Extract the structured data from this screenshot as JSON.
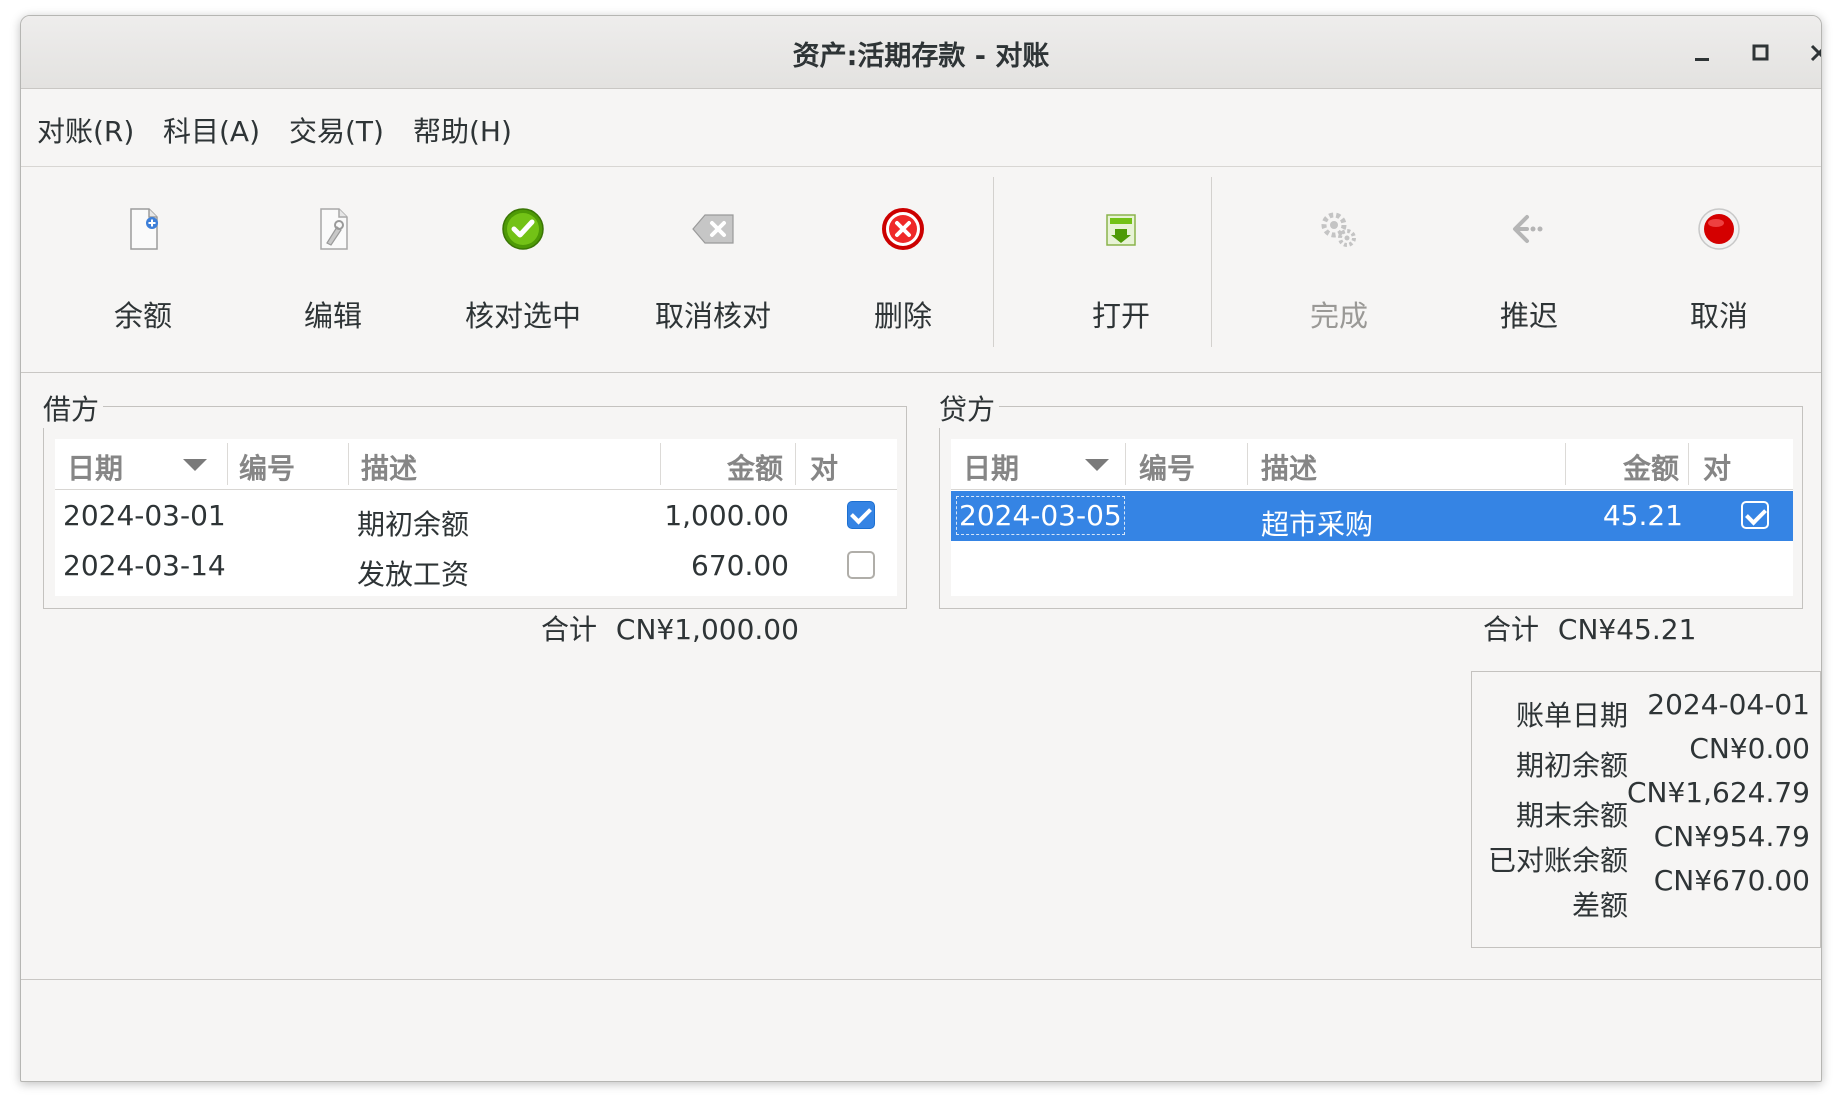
{
  "window": {
    "title": "资产:活期存款 - 对账",
    "controls": {
      "minimize": "–",
      "maximize": "□",
      "close": "✕"
    }
  },
  "menubar": {
    "items": [
      "对账(R)",
      "科目(A)",
      "交易(T)",
      "帮助(H)"
    ]
  },
  "toolbar": {
    "buttons": [
      {
        "label": "余额",
        "icon": "new-balance-icon",
        "enabled": true
      },
      {
        "label": "编辑",
        "icon": "edit-icon",
        "enabled": true
      },
      {
        "label": "核对选中",
        "icon": "reconcile-check-icon",
        "enabled": true
      },
      {
        "label": "取消核对",
        "icon": "unreconcile-backspace-icon",
        "enabled": true
      },
      {
        "label": "删除",
        "icon": "delete-icon",
        "enabled": true
      },
      {
        "label": "打开",
        "icon": "open-register-icon",
        "enabled": true
      },
      {
        "label": "完成",
        "icon": "finish-gears-icon",
        "enabled": false
      },
      {
        "label": "推迟",
        "icon": "postpone-icon",
        "enabled": true
      },
      {
        "label": "取消",
        "icon": "cancel-stop-icon",
        "enabled": true
      }
    ]
  },
  "debit": {
    "title": "借方",
    "columns": {
      "date": "日期",
      "num": "编号",
      "desc": "描述",
      "amount": "金额",
      "rec": "对"
    },
    "rows": [
      {
        "date": "2024-03-01",
        "num": "",
        "desc": "期初余额",
        "amount": "1,000.00",
        "reconciled": true
      },
      {
        "date": "2024-03-14",
        "num": "",
        "desc": "发放工资",
        "amount": "670.00",
        "reconciled": false
      }
    ],
    "total_label": "合计",
    "total_value": "CN¥1,000.00"
  },
  "credit": {
    "title": "贷方",
    "columns": {
      "date": "日期",
      "num": "编号",
      "desc": "描述",
      "amount": "金额",
      "rec": "对"
    },
    "rows": [
      {
        "date": "2024-03-05",
        "num": "",
        "desc": "超市采购",
        "amount": "45.21",
        "reconciled": true,
        "selected": true
      }
    ],
    "total_label": "合计",
    "total_value": "CN¥45.21"
  },
  "summary": {
    "statement_date_label": "账单日期",
    "statement_date": "2024-04-01",
    "starting_balance_label": "期初余额",
    "starting_balance": "CN¥0.00",
    "ending_balance_label": "期末余额",
    "ending_balance": "CN¥1,624.79",
    "reconciled_balance_label": "已对账余额",
    "reconciled_balance": "CN¥954.79",
    "difference_label": "差额",
    "difference": "CN¥670.00"
  },
  "colors": {
    "selection": "#3584e4",
    "window_bg": "#f6f5f4",
    "disabled_text": "#9a9996"
  }
}
